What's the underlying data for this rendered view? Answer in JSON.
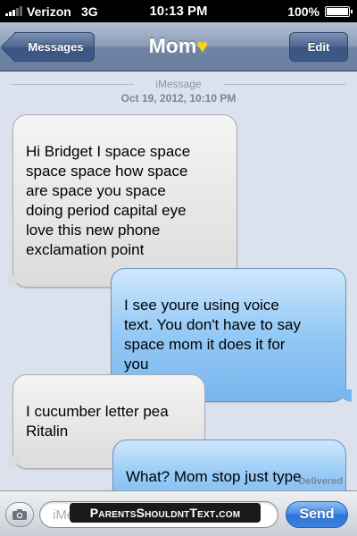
{
  "status_bar": {
    "carrier": "Verizon",
    "network": "3G",
    "time": "10:13 PM",
    "battery_percent": "100%"
  },
  "nav": {
    "back_label": "Messages",
    "title": "Mom",
    "title_icon": "yellow-heart-icon",
    "edit_label": "Edit"
  },
  "thread": {
    "service": "iMessage",
    "timestamp": "Oct 19, 2012, 10:10 PM",
    "messages": [
      {
        "direction": "incoming",
        "text": "Hi Bridget I space space\nspace space how space\nare space you space\ndoing period capital eye\nlove this new phone\nexclamation point"
      },
      {
        "direction": "outgoing",
        "text": "I see youre using voice\ntext. You don't have to say\nspace mom it does it for\nyou"
      },
      {
        "direction": "incoming",
        "text": "I cucumber letter pea\nRitalin"
      },
      {
        "direction": "outgoing",
        "text": "What? Mom stop just type"
      }
    ],
    "delivered_label": "Delivered"
  },
  "input_bar": {
    "placeholder": "iMessage",
    "send_label": "Send",
    "watermark": "ParentsShouldntText.com"
  },
  "colors": {
    "outgoing_bubble": "#98cbf6",
    "incoming_bubble": "#e8e8e8",
    "background": "#dbe2ed",
    "send_button": "#3f86e0"
  }
}
